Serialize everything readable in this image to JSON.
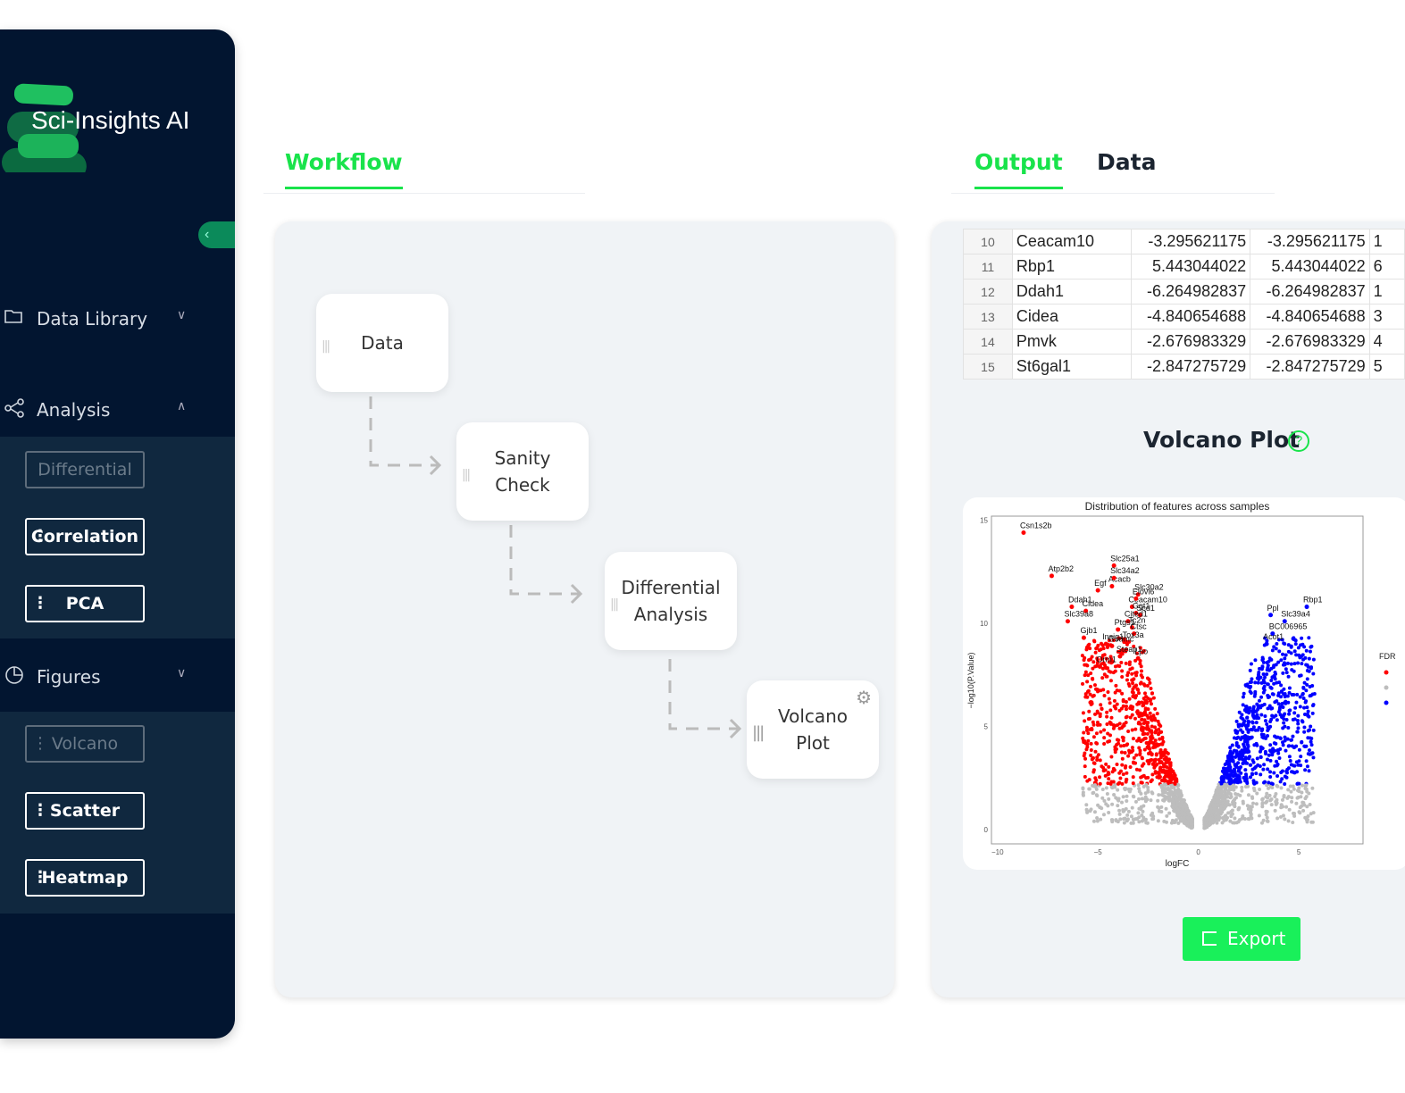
{
  "app": {
    "title": "Sci-Insights AI"
  },
  "sidebar": {
    "sections": [
      {
        "label": "Data Library",
        "icon": "folder-icon",
        "expanded": false
      },
      {
        "label": "Analysis",
        "icon": "share-nodes-icon",
        "expanded": true,
        "items": [
          {
            "label": "Differential",
            "disabled": true
          },
          {
            "label": "Correlation"
          },
          {
            "label": "PCA"
          }
        ]
      },
      {
        "label": "Figures",
        "icon": "pie-chart-icon",
        "expanded": true,
        "items": [
          {
            "label": "Volcano",
            "disabled": true
          },
          {
            "label": "Scatter"
          },
          {
            "label": "Heatmap"
          }
        ]
      }
    ]
  },
  "workflow": {
    "tab": "Workflow",
    "nodes": [
      {
        "label": "Data"
      },
      {
        "label": "Sanity Check"
      },
      {
        "label": "Differential Analysis"
      },
      {
        "label": "Volcano Plot"
      }
    ]
  },
  "output": {
    "tabs": [
      "Output",
      "Data"
    ],
    "active_tab": "Output",
    "table": {
      "rows": [
        [
          "10",
          "Ceacam10",
          "-3.295621175",
          "-3.295621175",
          "1"
        ],
        [
          "11",
          "Rbp1",
          "5.443044022",
          "5.443044022",
          "6"
        ],
        [
          "12",
          "Ddah1",
          "-6.264982837",
          "-6.264982837",
          "1"
        ],
        [
          "13",
          "Cidea",
          "-4.840654688",
          "-4.840654688",
          "3"
        ],
        [
          "14",
          "Pmvk",
          "-2.676983329",
          "-2.676983329",
          "4"
        ],
        [
          "15",
          "St6gal1",
          "-2.847275729",
          "-2.847275729",
          "5"
        ]
      ]
    },
    "figure_title": "Volcano Plot",
    "export_label": "Export"
  },
  "colors": {
    "accent": "#19e34b",
    "sidebar": "#021530",
    "down": "#ff0000",
    "up": "#0000ff",
    "ns": "#bdbdbd"
  },
  "chart_data": {
    "type": "scatter",
    "title": "Distribution of features across samples",
    "xlabel": "logFC",
    "ylabel": "−log10(P.Value)",
    "xlim": [
      -10.3,
      8.2
    ],
    "ylim": [
      -0.7,
      15.2
    ],
    "xticks": [
      -10,
      -5,
      0,
      5
    ],
    "yticks": [
      0,
      5,
      10,
      15
    ],
    "legend": {
      "title": "FDR",
      "placement": "right"
    },
    "labeled_points": [
      {
        "name": "Csn1s2b",
        "x": -8.7,
        "y": 14.4,
        "group": "down"
      },
      {
        "name": "Atp2b2",
        "x": -7.3,
        "y": 12.3,
        "group": "down"
      },
      {
        "name": "Slc25a1",
        "x": -4.2,
        "y": 12.8,
        "group": "down"
      },
      {
        "name": "Acacb",
        "x": -4.3,
        "y": 11.8,
        "group": "down"
      },
      {
        "name": "Slc34a2",
        "x": -4.2,
        "y": 12.2,
        "group": "down"
      },
      {
        "name": "Slc30a2",
        "x": -3.0,
        "y": 11.4,
        "group": "down"
      },
      {
        "name": "Egf",
        "x": -5.0,
        "y": 11.6,
        "group": "down"
      },
      {
        "name": "Ceacam10",
        "x": -3.3,
        "y": 10.8,
        "group": "down"
      },
      {
        "name": "Elovl6",
        "x": -3.1,
        "y": 11.2,
        "group": "down"
      },
      {
        "name": "Ddah1",
        "x": -6.3,
        "y": 10.8,
        "group": "down"
      },
      {
        "name": "Cidea",
        "x": -5.6,
        "y": 10.6,
        "group": "down"
      },
      {
        "name": "Ggt1",
        "x": -3.1,
        "y": 10.5,
        "group": "down"
      },
      {
        "name": "Scd1",
        "x": -2.9,
        "y": 10.4,
        "group": "down"
      },
      {
        "name": "Slc39a8",
        "x": -6.5,
        "y": 10.1,
        "group": "down"
      },
      {
        "name": "Cited1",
        "x": -3.5,
        "y": 10.1,
        "group": "down"
      },
      {
        "name": "Ptgs1",
        "x": -4.0,
        "y": 9.7,
        "group": "down"
      },
      {
        "name": "Tc2n",
        "x": -3.3,
        "y": 9.8,
        "group": "down"
      },
      {
        "name": "Ctsc",
        "x": -3.2,
        "y": 9.5,
        "group": "down"
      },
      {
        "name": "Gjb1",
        "x": -5.7,
        "y": 9.3,
        "group": "down"
      },
      {
        "name": "Insig1",
        "x": -4.6,
        "y": 9.0,
        "group": "down"
      },
      {
        "name": "Tox3a",
        "x": -3.6,
        "y": 9.1,
        "group": "down"
      },
      {
        "name": "Gsdmc",
        "x": -4.3,
        "y": 8.9,
        "group": "down"
      },
      {
        "name": "Steap1",
        "x": -3.9,
        "y": 8.4,
        "group": "down"
      },
      {
        "name": "Orm1",
        "x": -4.9,
        "y": 7.9,
        "group": "down"
      },
      {
        "name": "Lpo",
        "x": -3.0,
        "y": 8.3,
        "group": "down"
      },
      {
        "name": "Rbp1",
        "x": 5.4,
        "y": 10.8,
        "group": "up"
      },
      {
        "name": "Ppl",
        "x": 3.6,
        "y": 10.4,
        "group": "up"
      },
      {
        "name": "Slc39a4",
        "x": 4.3,
        "y": 10.1,
        "group": "up"
      },
      {
        "name": "BC006965",
        "x": 3.7,
        "y": 9.5,
        "group": "up"
      },
      {
        "name": "Acot1",
        "x": 3.4,
        "y": 9.0,
        "group": "up"
      }
    ]
  }
}
